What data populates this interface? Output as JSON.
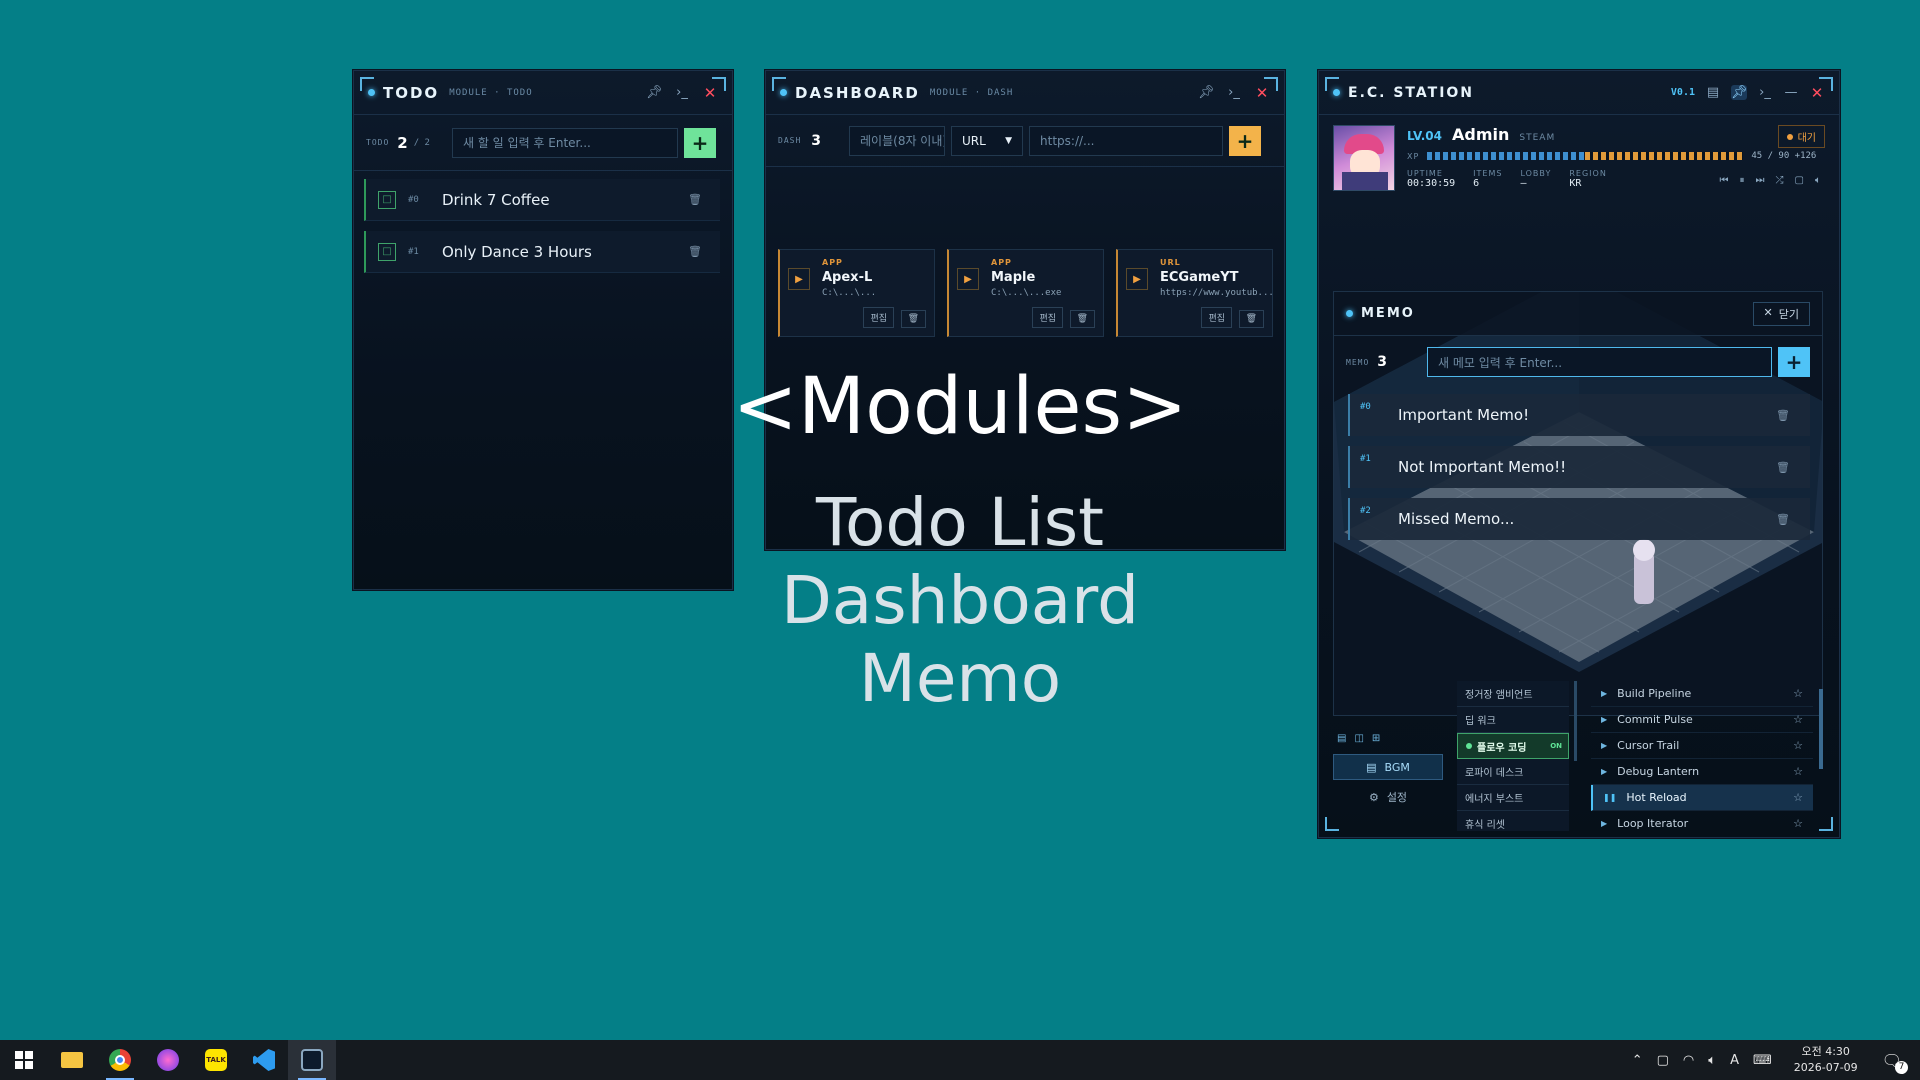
{
  "overlay": {
    "heading": "<Modules>",
    "items": [
      "Todo List",
      "Dashboard",
      "Memo"
    ]
  },
  "todo": {
    "title": "TODO",
    "subtitle": "MODULE · TODO",
    "counter_label": "TODO",
    "count": "2",
    "total": "/ 2",
    "input_placeholder": "새 할 일 입력 후 Enter...",
    "add_label": "+",
    "items": [
      {
        "index": "#0",
        "text": "Drink 7 Coffee"
      },
      {
        "index": "#1",
        "text": "Only Dance 3 Hours"
      }
    ]
  },
  "dashboard": {
    "title": "DASHBOARD",
    "subtitle": "MODULE · DASH",
    "counter_label": "DASH",
    "count": "3",
    "label_placeholder": "레이블(8자 이내)",
    "type_value": "URL",
    "url_placeholder": "https://...",
    "add_label": "+",
    "cards": [
      {
        "type": "APP",
        "name": "Apex-L",
        "path": "C:\\...\\...",
        "edit": "편집"
      },
      {
        "type": "APP",
        "name": "Maple",
        "path": "C:\\...\\...exe",
        "edit": "편집"
      },
      {
        "type": "URL",
        "name": "ECGameYT",
        "path": "https://www.youtub...",
        "edit": "편집"
      }
    ]
  },
  "station": {
    "title": "E.C. STATION",
    "version": "V0.1",
    "level": "LV.04",
    "user": "Admin",
    "platform": "STEAM",
    "status": "대기",
    "xp_label": "XP",
    "xp_value": "45 / 90 +126",
    "xp_fraction": 0.5,
    "stats": [
      {
        "label": "UPTIME",
        "value": "00:30:59"
      },
      {
        "label": "ITEMS",
        "value": "6"
      },
      {
        "label": "LOBBY",
        "value": "—"
      },
      {
        "label": "REGION",
        "value": "KR"
      }
    ],
    "memo": {
      "title": "MEMO",
      "close_label": "닫기",
      "counter_label": "MEMO",
      "count": "3",
      "input_placeholder": "새 메모 입력 후 Enter...",
      "add_label": "+",
      "items": [
        {
          "index": "#0",
          "text": "Important Memo!"
        },
        {
          "index": "#1",
          "text": "Not Important Memo!!"
        },
        {
          "index": "#2",
          "text": "Missed Memo..."
        }
      ]
    },
    "side_tabs": {
      "bgm": "BGM",
      "settings": "설정"
    },
    "categories": [
      "정거장 앰비언트",
      "딥 워크",
      "플로우 코딩",
      "로파이 데스크",
      "에너지 부스트",
      "휴식 리셋"
    ],
    "active_category": "플로우 코딩",
    "active_badge": "ON",
    "tracks": [
      {
        "name": "Build Pipeline",
        "playing": false
      },
      {
        "name": "Commit Pulse",
        "playing": false
      },
      {
        "name": "Cursor Trail",
        "playing": false
      },
      {
        "name": "Debug Lantern",
        "playing": false
      },
      {
        "name": "Hot Reload",
        "playing": true
      },
      {
        "name": "Loop Iterator",
        "playing": false
      }
    ]
  },
  "taskbar": {
    "time": "오전 4:30",
    "date": "2026-07-09",
    "notif_count": "7",
    "ime": "A"
  }
}
